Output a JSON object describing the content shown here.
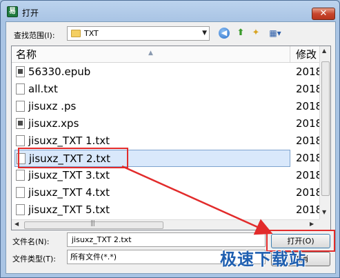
{
  "window": {
    "title": "打开",
    "close_label": "✕"
  },
  "lookin": {
    "label": "查找范围(I):",
    "value": "TXT"
  },
  "columns": {
    "name": "名称",
    "modified": "修改"
  },
  "files": [
    {
      "name": "56330.epub",
      "date": "2018",
      "icon": "ebook-file-icon"
    },
    {
      "name": "all.txt",
      "date": "2018",
      "icon": "text-file-icon"
    },
    {
      "name": "jisuxz .ps",
      "date": "2018",
      "icon": "text-file-icon"
    },
    {
      "name": "jisuxz.xps",
      "date": "2018",
      "icon": "xps-file-icon"
    },
    {
      "name": "jisuxz_TXT 1.txt",
      "date": "2018",
      "icon": "text-file-icon"
    },
    {
      "name": "jisuxz_TXT 2.txt",
      "date": "2018",
      "icon": "text-file-icon",
      "selected": true
    },
    {
      "name": "jisuxz_TXT 3.txt",
      "date": "2018",
      "icon": "text-file-icon"
    },
    {
      "name": "jisuxz_TXT 4.txt",
      "date": "2018",
      "icon": "text-file-icon"
    },
    {
      "name": "jisuxz_TXT 5.txt",
      "date": "2018",
      "icon": "text-file-icon"
    }
  ],
  "filename": {
    "label": "文件名(N):",
    "value": "jisuxz_TXT 2.txt"
  },
  "filetype": {
    "label": "文件类型(T):",
    "value": "所有文件(*.*)"
  },
  "buttons": {
    "open": "打开(O)",
    "cancel": "取消"
  },
  "watermark": "极速下载站",
  "colors": {
    "highlight": "#e22b2b",
    "selection": "#d9e8fb"
  }
}
